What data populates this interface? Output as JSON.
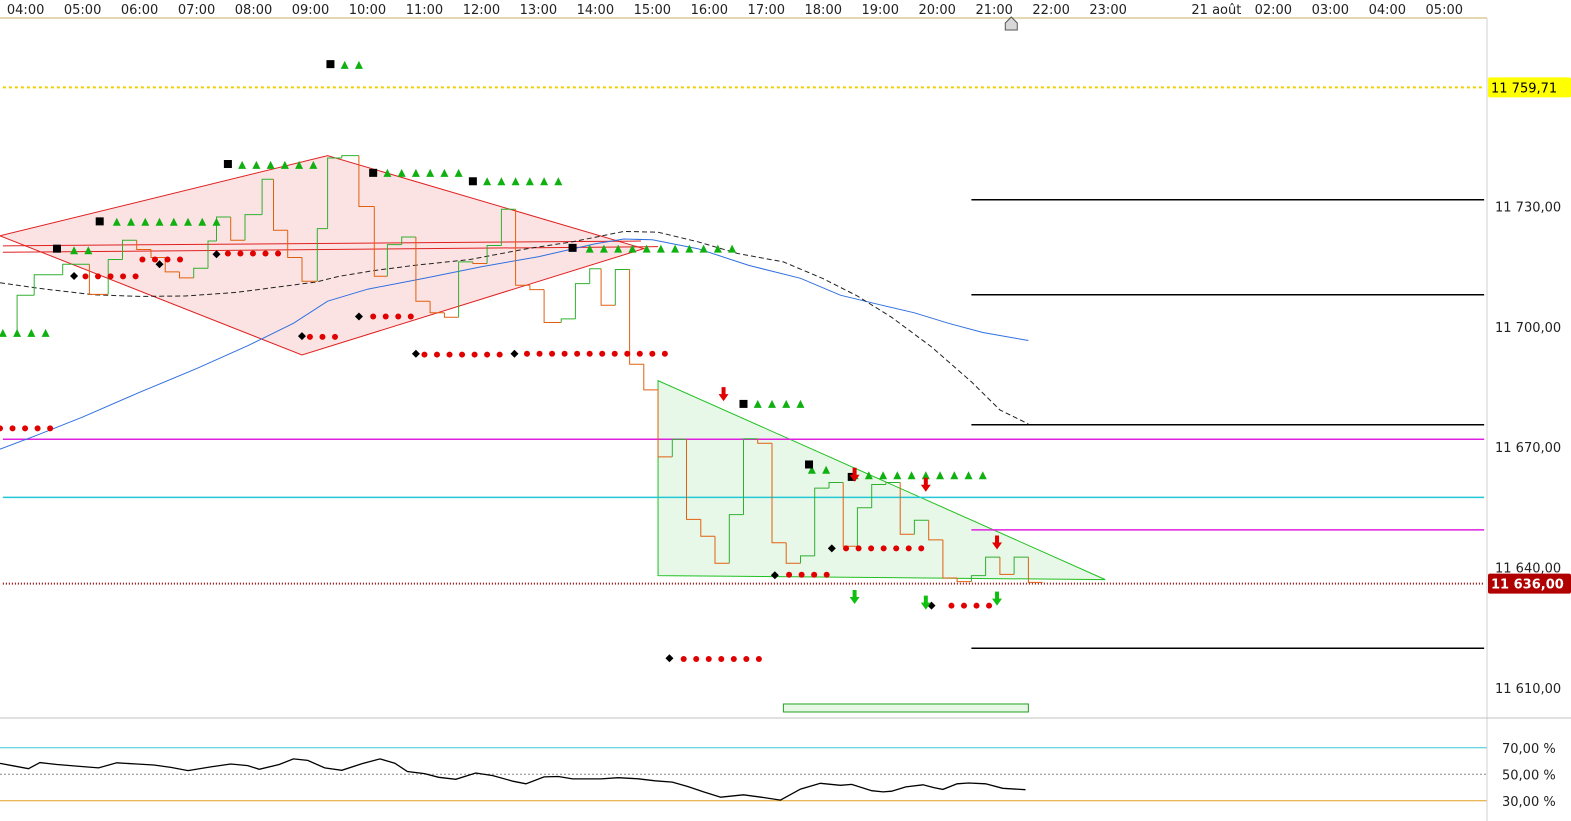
{
  "chart_data": [
    {
      "type": "line",
      "panel": "price",
      "x_axis_labels": [
        "04:00",
        "05:00",
        "06:00",
        "07:00",
        "08:00",
        "09:00",
        "10:00",
        "11:00",
        "12:00",
        "13:00",
        "14:00",
        "15:00",
        "16:00",
        "17:00",
        "18:00",
        "19:00",
        "20:00",
        "21:00",
        "22:00",
        "23:00",
        "21 août",
        "02:00",
        "03:00",
        "04:00",
        "05:00"
      ],
      "y_ticks": [
        {
          "value": 11730,
          "label": "11 730,00"
        },
        {
          "value": 11700,
          "label": "11 700,00"
        },
        {
          "value": 11670,
          "label": "11 670,00"
        },
        {
          "value": 11640,
          "label": "11 640,00"
        },
        {
          "value": 11610,
          "label": "11 610,00"
        }
      ],
      "ylim": [
        11603,
        11777
      ],
      "xlim": [
        3.55,
        29.65
      ],
      "price_flags": [
        {
          "value": 11759.71,
          "label": "11 759,71",
          "bg": "#ffff00",
          "fg": "#000000"
        },
        {
          "value": 11636.0,
          "label": "11 636,00",
          "bg": "#b00000",
          "fg": "#ffffff"
        }
      ],
      "horizontal_levels": [
        {
          "value": 11759.71,
          "color": "#f0d000",
          "style": "dotted",
          "x_from": 3.6,
          "x_to": 29.6
        },
        {
          "value": 11636.0,
          "color": "#8b0000",
          "style": "dotted",
          "x_from": 3.6,
          "x_to": 29.6
        },
        {
          "value": 11672.0,
          "color": "#e020e0",
          "style": "solid",
          "x_from": 3.6,
          "x_to": 29.6
        },
        {
          "value": 11657.5,
          "color": "#20c8d8",
          "style": "solid",
          "x_from": 3.6,
          "x_to": 29.6
        },
        {
          "value": 11731.7,
          "color": "#000000",
          "style": "solid",
          "x_from": 20.6,
          "x_to": 29.6
        },
        {
          "value": 11708.0,
          "color": "#000000",
          "style": "solid",
          "x_from": 20.6,
          "x_to": 29.6
        },
        {
          "value": 11675.6,
          "color": "#000000",
          "style": "solid",
          "x_from": 20.6,
          "x_to": 29.6
        },
        {
          "value": 11649.4,
          "color": "#e020e0",
          "style": "solid",
          "x_from": 20.6,
          "x_to": 29.6
        },
        {
          "value": 11619.9,
          "color": "#000000",
          "style": "solid",
          "x_from": 20.6,
          "x_to": 29.6
        }
      ],
      "price_steps": [
        [
          3.5,
          11698.3
        ],
        [
          3.85,
          11707.9
        ],
        [
          4.15,
          11713.0
        ],
        [
          4.65,
          11715.6
        ],
        [
          5.12,
          11708.1
        ],
        [
          5.45,
          11716.8
        ],
        [
          5.7,
          11721.6
        ],
        [
          5.95,
          11719.3
        ],
        [
          6.2,
          11717.3
        ],
        [
          6.45,
          11713.7
        ],
        [
          6.7,
          11712.2
        ],
        [
          6.95,
          11714.6
        ],
        [
          7.2,
          11721.4
        ],
        [
          7.35,
          11727.4
        ],
        [
          7.6,
          11721.6
        ],
        [
          7.85,
          11728.0
        ],
        [
          8.15,
          11736.8
        ],
        [
          8.35,
          11724.1
        ],
        [
          8.6,
          11717.3
        ],
        [
          8.85,
          11711.4
        ],
        [
          9.12,
          11724.5
        ],
        [
          9.3,
          11742.1
        ],
        [
          9.55,
          11742.7
        ],
        [
          9.85,
          11730.0
        ],
        [
          10.12,
          11712.6
        ],
        [
          10.35,
          11720.5
        ],
        [
          10.6,
          11722.4
        ],
        [
          10.85,
          11706.4
        ],
        [
          11.1,
          11703.5
        ],
        [
          11.35,
          11702.4
        ],
        [
          11.6,
          11716.2
        ],
        [
          11.85,
          11715.8
        ],
        [
          12.1,
          11720.3
        ],
        [
          12.35,
          11729.3
        ],
        [
          12.6,
          11710.4
        ],
        [
          12.85,
          11709.3
        ],
        [
          13.1,
          11701.1
        ],
        [
          13.4,
          11702.0
        ],
        [
          13.65,
          11710.8
        ],
        [
          13.9,
          11714.5
        ],
        [
          14.1,
          11705.4
        ],
        [
          14.35,
          11714.3
        ],
        [
          14.6,
          11690.7
        ],
        [
          14.85,
          11684.3
        ],
        [
          15.1,
          11667.6
        ],
        [
          15.35,
          11672.0
        ],
        [
          15.6,
          11652.0
        ],
        [
          15.85,
          11647.8
        ],
        [
          16.1,
          11641.1
        ],
        [
          16.35,
          11653.2
        ],
        [
          16.6,
          11672.1
        ],
        [
          16.85,
          11671.0
        ],
        [
          17.1,
          11646.2
        ],
        [
          17.35,
          11641.1
        ],
        [
          17.6,
          11642.9
        ],
        [
          17.85,
          11659.8
        ],
        [
          18.1,
          11661.2
        ],
        [
          18.35,
          11645.3
        ],
        [
          18.6,
          11654.9
        ],
        [
          18.85,
          11660.7
        ],
        [
          19.1,
          11661.2
        ],
        [
          19.35,
          11648.3
        ],
        [
          19.6,
          11651.8
        ],
        [
          19.85,
          11646.9
        ],
        [
          20.1,
          11637.4
        ],
        [
          20.35,
          11636.5
        ],
        [
          20.6,
          11638.0
        ],
        [
          20.85,
          11642.6
        ],
        [
          21.1,
          11638.3
        ],
        [
          21.35,
          11642.6
        ],
        [
          21.6,
          11636.3
        ]
      ],
      "ma_blue": [
        [
          3.55,
          11669.5
        ],
        [
          4.2,
          11673
        ],
        [
          5.0,
          11677.5
        ],
        [
          6.0,
          11683.7
        ],
        [
          7.0,
          11689.6
        ],
        [
          7.9,
          11695.3
        ],
        [
          8.7,
          11700.9
        ],
        [
          9.3,
          11706.4
        ],
        [
          10.0,
          11709.4
        ],
        [
          11.0,
          11712.1
        ],
        [
          12.0,
          11715.0
        ],
        [
          13.0,
          11717.5
        ],
        [
          14.0,
          11720.7
        ],
        [
          14.5,
          11721.9
        ],
        [
          15.0,
          11721.7
        ],
        [
          15.8,
          11719.5
        ],
        [
          16.7,
          11715.3
        ],
        [
          17.6,
          11712.1
        ],
        [
          18.3,
          11707.9
        ],
        [
          19.0,
          11705.5
        ],
        [
          19.6,
          11703.5
        ],
        [
          20.2,
          11700.9
        ],
        [
          20.8,
          11698.6
        ],
        [
          21.6,
          11696.6
        ]
      ],
      "ma_dashed": [
        [
          3.55,
          11711.0
        ],
        [
          4.3,
          11709.5
        ],
        [
          5.2,
          11708.0
        ],
        [
          6.0,
          11707.6
        ],
        [
          6.8,
          11707.7
        ],
        [
          7.7,
          11708.6
        ],
        [
          8.4,
          11709.9
        ],
        [
          9.1,
          11711.2
        ],
        [
          9.5,
          11712.6
        ],
        [
          10.1,
          11714.0
        ],
        [
          10.8,
          11715.3
        ],
        [
          11.8,
          11716.8
        ],
        [
          12.8,
          11719.5
        ],
        [
          13.6,
          11721.2
        ],
        [
          14.5,
          11723.8
        ],
        [
          15.1,
          11723.6
        ],
        [
          15.8,
          11721.2
        ],
        [
          16.5,
          11718.3
        ],
        [
          17.3,
          11716.2
        ],
        [
          18.0,
          11712.0
        ],
        [
          18.6,
          11707.7
        ],
        [
          19.2,
          11702.4
        ],
        [
          19.9,
          11695.0
        ],
        [
          20.6,
          11686.3
        ],
        [
          21.1,
          11679.3
        ],
        [
          21.6,
          11675.8
        ]
      ],
      "diamond_pattern": {
        "points": [
          [
            3.55,
            11722.7
          ],
          [
            9.3,
            11742.7
          ],
          [
            14.85,
            11719.5
          ],
          [
            8.85,
            11693.0
          ]
        ],
        "fill": "#fbdede",
        "stroke": "#e02020"
      },
      "diamond_inner_line": [
        [
          3.6,
          11718.6
        ],
        [
          15.1,
          11720.0
        ]
      ],
      "diamond_inner_line2": [
        [
          3.6,
          11720.2
        ],
        [
          14.8,
          11721.4
        ]
      ],
      "triangle_pattern": {
        "points": [
          [
            15.1,
            11686.6
          ],
          [
            22.95,
            11637.0
          ],
          [
            15.1,
            11638.0
          ]
        ],
        "fill": "#e6f7e6",
        "stroke": "#20c020"
      },
      "green_box": {
        "x1": 17.3,
        "x2": 21.6,
        "y1": 11603,
        "y2": 11604.5
      },
      "signals_up_triangles": [
        {
          "x0": 3.6,
          "y": 11698.5,
          "n": 4,
          "dx": 0.25
        },
        {
          "x0": 4.85,
          "y": 11719.1,
          "n": 2,
          "dx": 0.25
        },
        {
          "x0": 5.6,
          "y": 11726.2,
          "n": 8,
          "dx": 0.25
        },
        {
          "x0": 7.8,
          "y": 11740.4,
          "n": 6,
          "dx": 0.25
        },
        {
          "x0": 9.6,
          "y": 11765.3,
          "n": 2,
          "dx": 0.25
        },
        {
          "x0": 10.35,
          "y": 11738.4,
          "n": 6,
          "dx": 0.25
        },
        {
          "x0": 12.1,
          "y": 11736.3,
          "n": 6,
          "dx": 0.25
        },
        {
          "x0": 13.9,
          "y": 11719.5,
          "n": 11,
          "dx": 0.25
        },
        {
          "x0": 16.85,
          "y": 11680.8,
          "n": 4,
          "dx": 0.25
        },
        {
          "x0": 17.8,
          "y": 11664.4,
          "n": 2,
          "dx": 0.25
        },
        {
          "x0": 18.55,
          "y": 11663.0,
          "n": 10,
          "dx": 0.25
        }
      ],
      "signals_squares": [
        [
          4.55,
          11719.5
        ],
        [
          5.3,
          11726.3
        ],
        [
          7.55,
          11740.6
        ],
        [
          9.35,
          11765.5
        ],
        [
          10.1,
          11738.4
        ],
        [
          11.85,
          11736.3
        ],
        [
          13.6,
          11719.7
        ],
        [
          16.6,
          11680.8
        ],
        [
          17.75,
          11665.7
        ],
        [
          18.5,
          11662.6
        ]
      ],
      "signals_red_dots": [
        {
          "x0": 3.55,
          "y": 11674.7,
          "n": 5,
          "dx": 0.22
        },
        {
          "x0": 5.05,
          "y": 11712.6,
          "n": 5,
          "dx": 0.22
        },
        {
          "x0": 6.05,
          "y": 11716.8,
          "n": 4,
          "dx": 0.22
        },
        {
          "x0": 7.55,
          "y": 11718.3,
          "n": 5,
          "dx": 0.22
        },
        {
          "x0": 8.99,
          "y": 11697.5,
          "n": 3,
          "dx": 0.22
        },
        {
          "x0": 10.1,
          "y": 11702.6,
          "n": 4,
          "dx": 0.22
        },
        {
          "x0": 11.0,
          "y": 11693.1,
          "n": 7,
          "dx": 0.22
        },
        {
          "x0": 12.8,
          "y": 11693.3,
          "n": 12,
          "dx": 0.22
        },
        {
          "x0": 15.55,
          "y": 11617.2,
          "n": 7,
          "dx": 0.22
        },
        {
          "x0": 17.4,
          "y": 11638.2,
          "n": 4,
          "dx": 0.22
        },
        {
          "x0": 18.4,
          "y": 11644.8,
          "n": 7,
          "dx": 0.22
        },
        {
          "x0": 20.25,
          "y": 11630.5,
          "n": 4,
          "dx": 0.22
        }
      ],
      "signals_diamonds": [
        [
          4.85,
          11712.7
        ],
        [
          6.35,
          11715.6
        ],
        [
          7.35,
          11718.1
        ],
        [
          8.85,
          11697.7
        ],
        [
          9.85,
          11702.6
        ],
        [
          10.85,
          11693.3
        ],
        [
          12.58,
          11693.3
        ],
        [
          15.3,
          11617.4
        ],
        [
          17.15,
          11638.1
        ],
        [
          18.15,
          11644.8
        ],
        [
          19.9,
          11630.5
        ]
      ],
      "signals_red_arrows": [
        [
          16.25,
          11683.0
        ],
        [
          18.55,
          11662.9
        ],
        [
          19.8,
          11660.4
        ],
        [
          21.05,
          11646.0
        ]
      ],
      "signals_green_arrows": [
        [
          18.55,
          11632.4
        ],
        [
          19.8,
          11631.0
        ],
        [
          21.05,
          11632.0
        ]
      ],
      "marker_house": 21.3
    },
    {
      "type": "line",
      "panel": "oscillator",
      "y_ticks": [
        {
          "value": 70,
          "label": "70,00 %"
        },
        {
          "value": 50,
          "label": "50,00 %"
        },
        {
          "value": 30,
          "label": "30,00 %"
        }
      ],
      "ylim": [
        17,
        91
      ],
      "levels": [
        {
          "value": 70,
          "color": "#38c8d8",
          "style": "solid"
        },
        {
          "value": 50,
          "color": "#888888",
          "style": "dotted"
        },
        {
          "value": 30,
          "color": "#e0a020",
          "style": "solid"
        }
      ],
      "series": [
        [
          3.55,
          58.2
        ],
        [
          3.78,
          56.4
        ],
        [
          4.05,
          54.2
        ],
        [
          4.25,
          58.8
        ],
        [
          4.55,
          57.4
        ],
        [
          4.95,
          56.0
        ],
        [
          5.28,
          54.8
        ],
        [
          5.6,
          58.7
        ],
        [
          5.95,
          57.8
        ],
        [
          6.25,
          57.0
        ],
        [
          6.55,
          55.2
        ],
        [
          6.85,
          52.8
        ],
        [
          7.25,
          55.6
        ],
        [
          7.6,
          57.8
        ],
        [
          7.9,
          56.6
        ],
        [
          8.1,
          53.8
        ],
        [
          8.45,
          57.4
        ],
        [
          8.7,
          61.6
        ],
        [
          8.95,
          60.5
        ],
        [
          9.25,
          54.8
        ],
        [
          9.55,
          53.0
        ],
        [
          9.9,
          58.0
        ],
        [
          10.22,
          61.6
        ],
        [
          10.48,
          58.4
        ],
        [
          10.7,
          52.1
        ],
        [
          11.0,
          50.5
        ],
        [
          11.25,
          47.7
        ],
        [
          11.55,
          46.2
        ],
        [
          11.9,
          51.0
        ],
        [
          12.2,
          49.0
        ],
        [
          12.55,
          44.8
        ],
        [
          12.78,
          42.8
        ],
        [
          13.1,
          48.0
        ],
        [
          13.35,
          48.3
        ],
        [
          13.6,
          46.5
        ],
        [
          14.1,
          46.5
        ],
        [
          14.4,
          47.4
        ],
        [
          14.75,
          46.6
        ],
        [
          15.05,
          45.1
        ],
        [
          15.35,
          44.1
        ],
        [
          15.62,
          40.8
        ],
        [
          15.9,
          36.7
        ],
        [
          16.2,
          32.7
        ],
        [
          16.6,
          34.5
        ],
        [
          16.95,
          32.5
        ],
        [
          17.25,
          30.5
        ],
        [
          17.6,
          38.8
        ],
        [
          17.95,
          43.2
        ],
        [
          18.3,
          41.7
        ],
        [
          18.5,
          42.4
        ],
        [
          18.85,
          37.6
        ],
        [
          19.05,
          36.7
        ],
        [
          19.2,
          37.2
        ],
        [
          19.45,
          40.5
        ],
        [
          19.75,
          42.1
        ],
        [
          19.95,
          39.8
        ],
        [
          20.1,
          38.6
        ],
        [
          20.35,
          42.8
        ],
        [
          20.55,
          43.4
        ],
        [
          20.85,
          42.8
        ],
        [
          21.15,
          39.4
        ],
        [
          21.55,
          38.4
        ]
      ]
    }
  ]
}
